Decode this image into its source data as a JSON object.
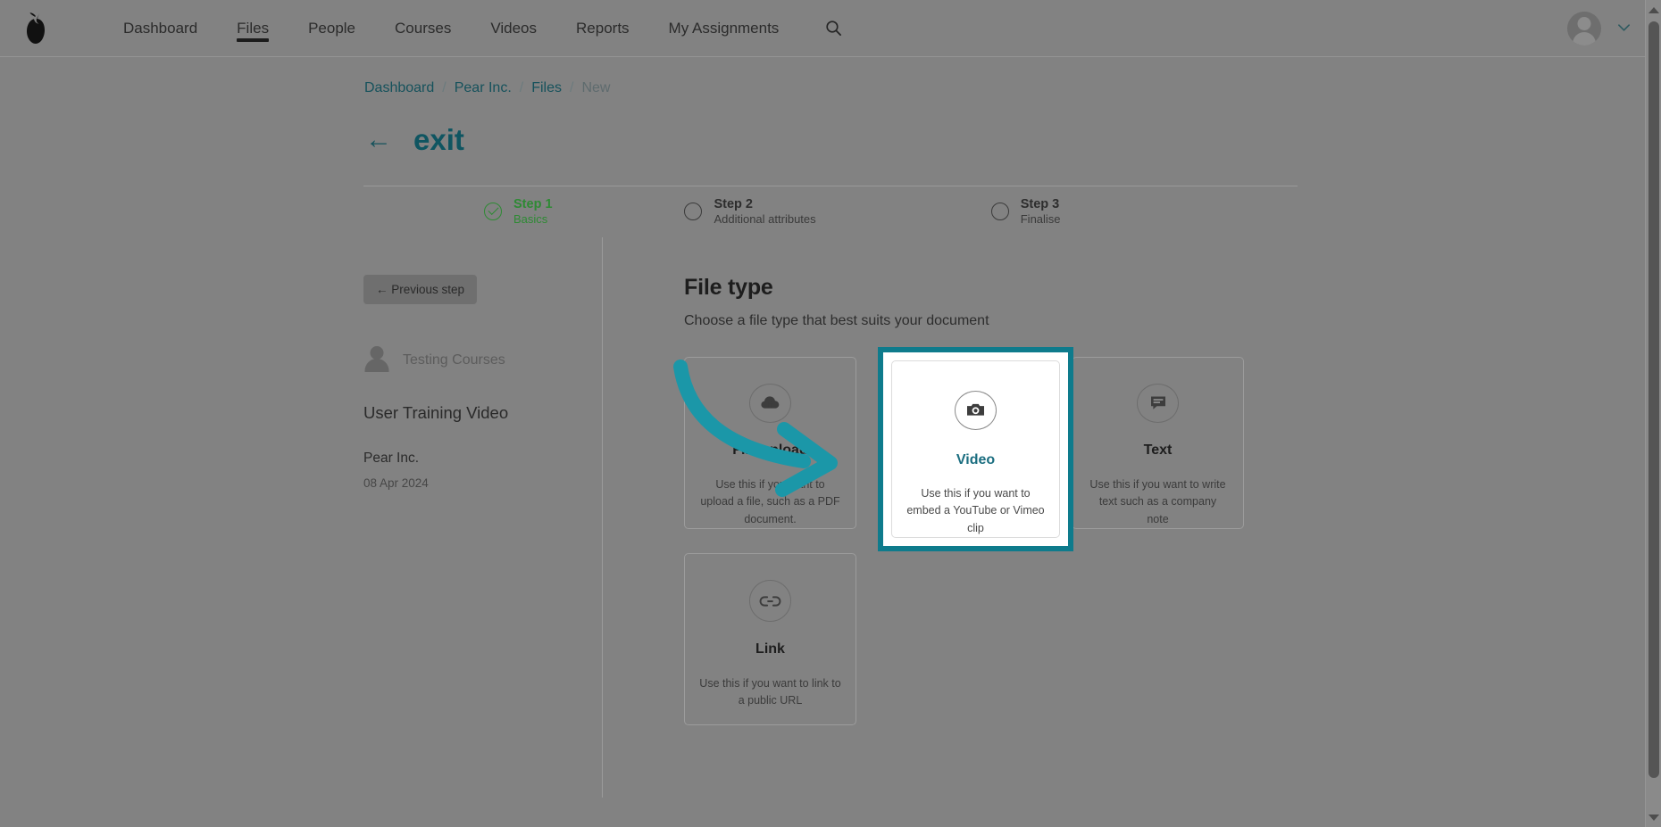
{
  "nav": {
    "logo_icon": "pear-logo",
    "items": [
      {
        "label": "Dashboard",
        "active": false
      },
      {
        "label": "Files",
        "active": true
      },
      {
        "label": "People",
        "active": false
      },
      {
        "label": "Courses",
        "active": false
      },
      {
        "label": "Videos",
        "active": false
      },
      {
        "label": "Reports",
        "active": false
      },
      {
        "label": "My Assignments",
        "active": false
      }
    ],
    "search_icon": "search-icon",
    "avatar_icon": "user-avatar-icon",
    "chevron_icon": "chevron-down-icon"
  },
  "breadcrumb": {
    "items": [
      "Dashboard",
      "Pear Inc.",
      "Files",
      "New"
    ],
    "separator": "/"
  },
  "header": {
    "back_arrow": "←",
    "title": "exit"
  },
  "steps": [
    {
      "title": "Step 1",
      "sub": "Basics",
      "state": "done"
    },
    {
      "title": "Step 2",
      "sub": "Additional attributes",
      "state": "todo"
    },
    {
      "title": "Step 3",
      "sub": "Finalise",
      "state": "todo"
    }
  ],
  "sidebar": {
    "previous_step_label": "← Previous step",
    "owner_name": "Testing Courses",
    "document_name": "User Training Video",
    "organisation": "Pear Inc.",
    "date": "08 Apr 2024"
  },
  "main": {
    "section_title": "File type",
    "section_subtitle": "Choose a file type that best suits your document",
    "cards": [
      {
        "id": "file-upload",
        "icon": "cloud-upload-icon",
        "title": "File upload",
        "desc": "Use this if you want to upload a file, such as a PDF document.",
        "selected": false
      },
      {
        "id": "video",
        "icon": "camera-icon",
        "title": "Video",
        "desc": "Use this if you want to embed a YouTube or Vimeo clip",
        "selected": true
      },
      {
        "id": "text",
        "icon": "comment-icon",
        "title": "Text",
        "desc": "Use this if you want to write text such as a company note",
        "selected": false
      },
      {
        "id": "link",
        "icon": "link-icon",
        "title": "Link",
        "desc": "Use this if you want to link to a public URL",
        "selected": false
      }
    ]
  },
  "annotation": {
    "type": "curved-arrow",
    "points_to": "video"
  },
  "colors": {
    "accent_teal": "#0e7b8c",
    "annotation_teal": "#1695a8",
    "breadcrumb_teal": "#16525c",
    "title_teal": "#0f5561",
    "step_done_green": "#2e8a34",
    "page_background": "#828282",
    "card_selected_background": "#ffffff"
  },
  "scrollbar": {
    "up_icon": "triangle-up-icon",
    "down_icon": "triangle-down-icon"
  }
}
